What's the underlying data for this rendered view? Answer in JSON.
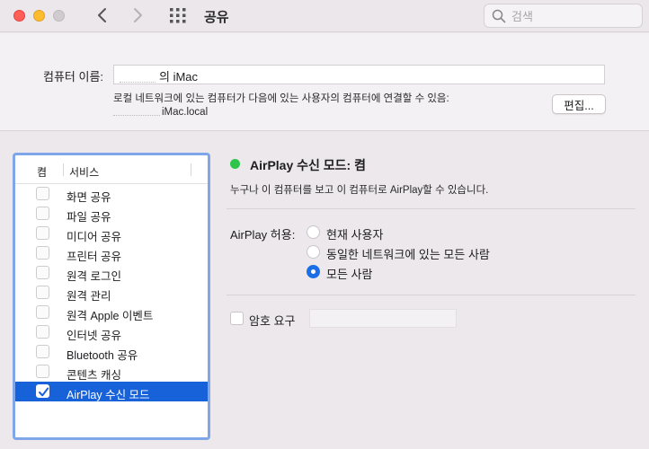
{
  "toolbar": {
    "title": "공유",
    "search_placeholder": "검색"
  },
  "computer_name": {
    "label": "컴퓨터 이름:",
    "value": "의 iMac",
    "lan_description": "로컬 네트워크에 있는 컴퓨터가 다음에 있는 사용자의 컴퓨터에 연결할 수 있음:",
    "lan_address": "iMac.local",
    "edit_button": "편집..."
  },
  "service_list": {
    "header_on": "켬",
    "header_service": "서비스",
    "items": [
      {
        "label": "화면 공유",
        "checked": false
      },
      {
        "label": "파일 공유",
        "checked": false
      },
      {
        "label": "미디어 공유",
        "checked": false
      },
      {
        "label": "프린터 공유",
        "checked": false
      },
      {
        "label": "원격 로그인",
        "checked": false
      },
      {
        "label": "원격 관리",
        "checked": false
      },
      {
        "label": "원격 Apple 이벤트",
        "checked": false
      },
      {
        "label": "인터넷 공유",
        "checked": false
      },
      {
        "label": "Bluetooth 공유",
        "checked": false
      },
      {
        "label": "콘텐츠 캐싱",
        "checked": false
      },
      {
        "label": "AirPlay 수신 모드",
        "checked": true,
        "selected": true
      }
    ]
  },
  "detail": {
    "status_label": "AirPlay 수신 모드: 켬",
    "status_color": "#2ec54a",
    "status_description": "누구나 이 컴퓨터를 보고 이 컴퓨터로 AirPlay할 수 있습니다.",
    "allow_label": "AirPlay 허용:",
    "allow_options": [
      {
        "label": "현재 사용자",
        "selected": false
      },
      {
        "label": "동일한 네트워크에 있는 모든 사람",
        "selected": false
      },
      {
        "label": "모든 사람",
        "selected": true
      }
    ],
    "password_label": "암호 요구",
    "password_value": ""
  },
  "colors": {
    "accent": "#1761d9",
    "selection_border": "#7ea6e8"
  }
}
